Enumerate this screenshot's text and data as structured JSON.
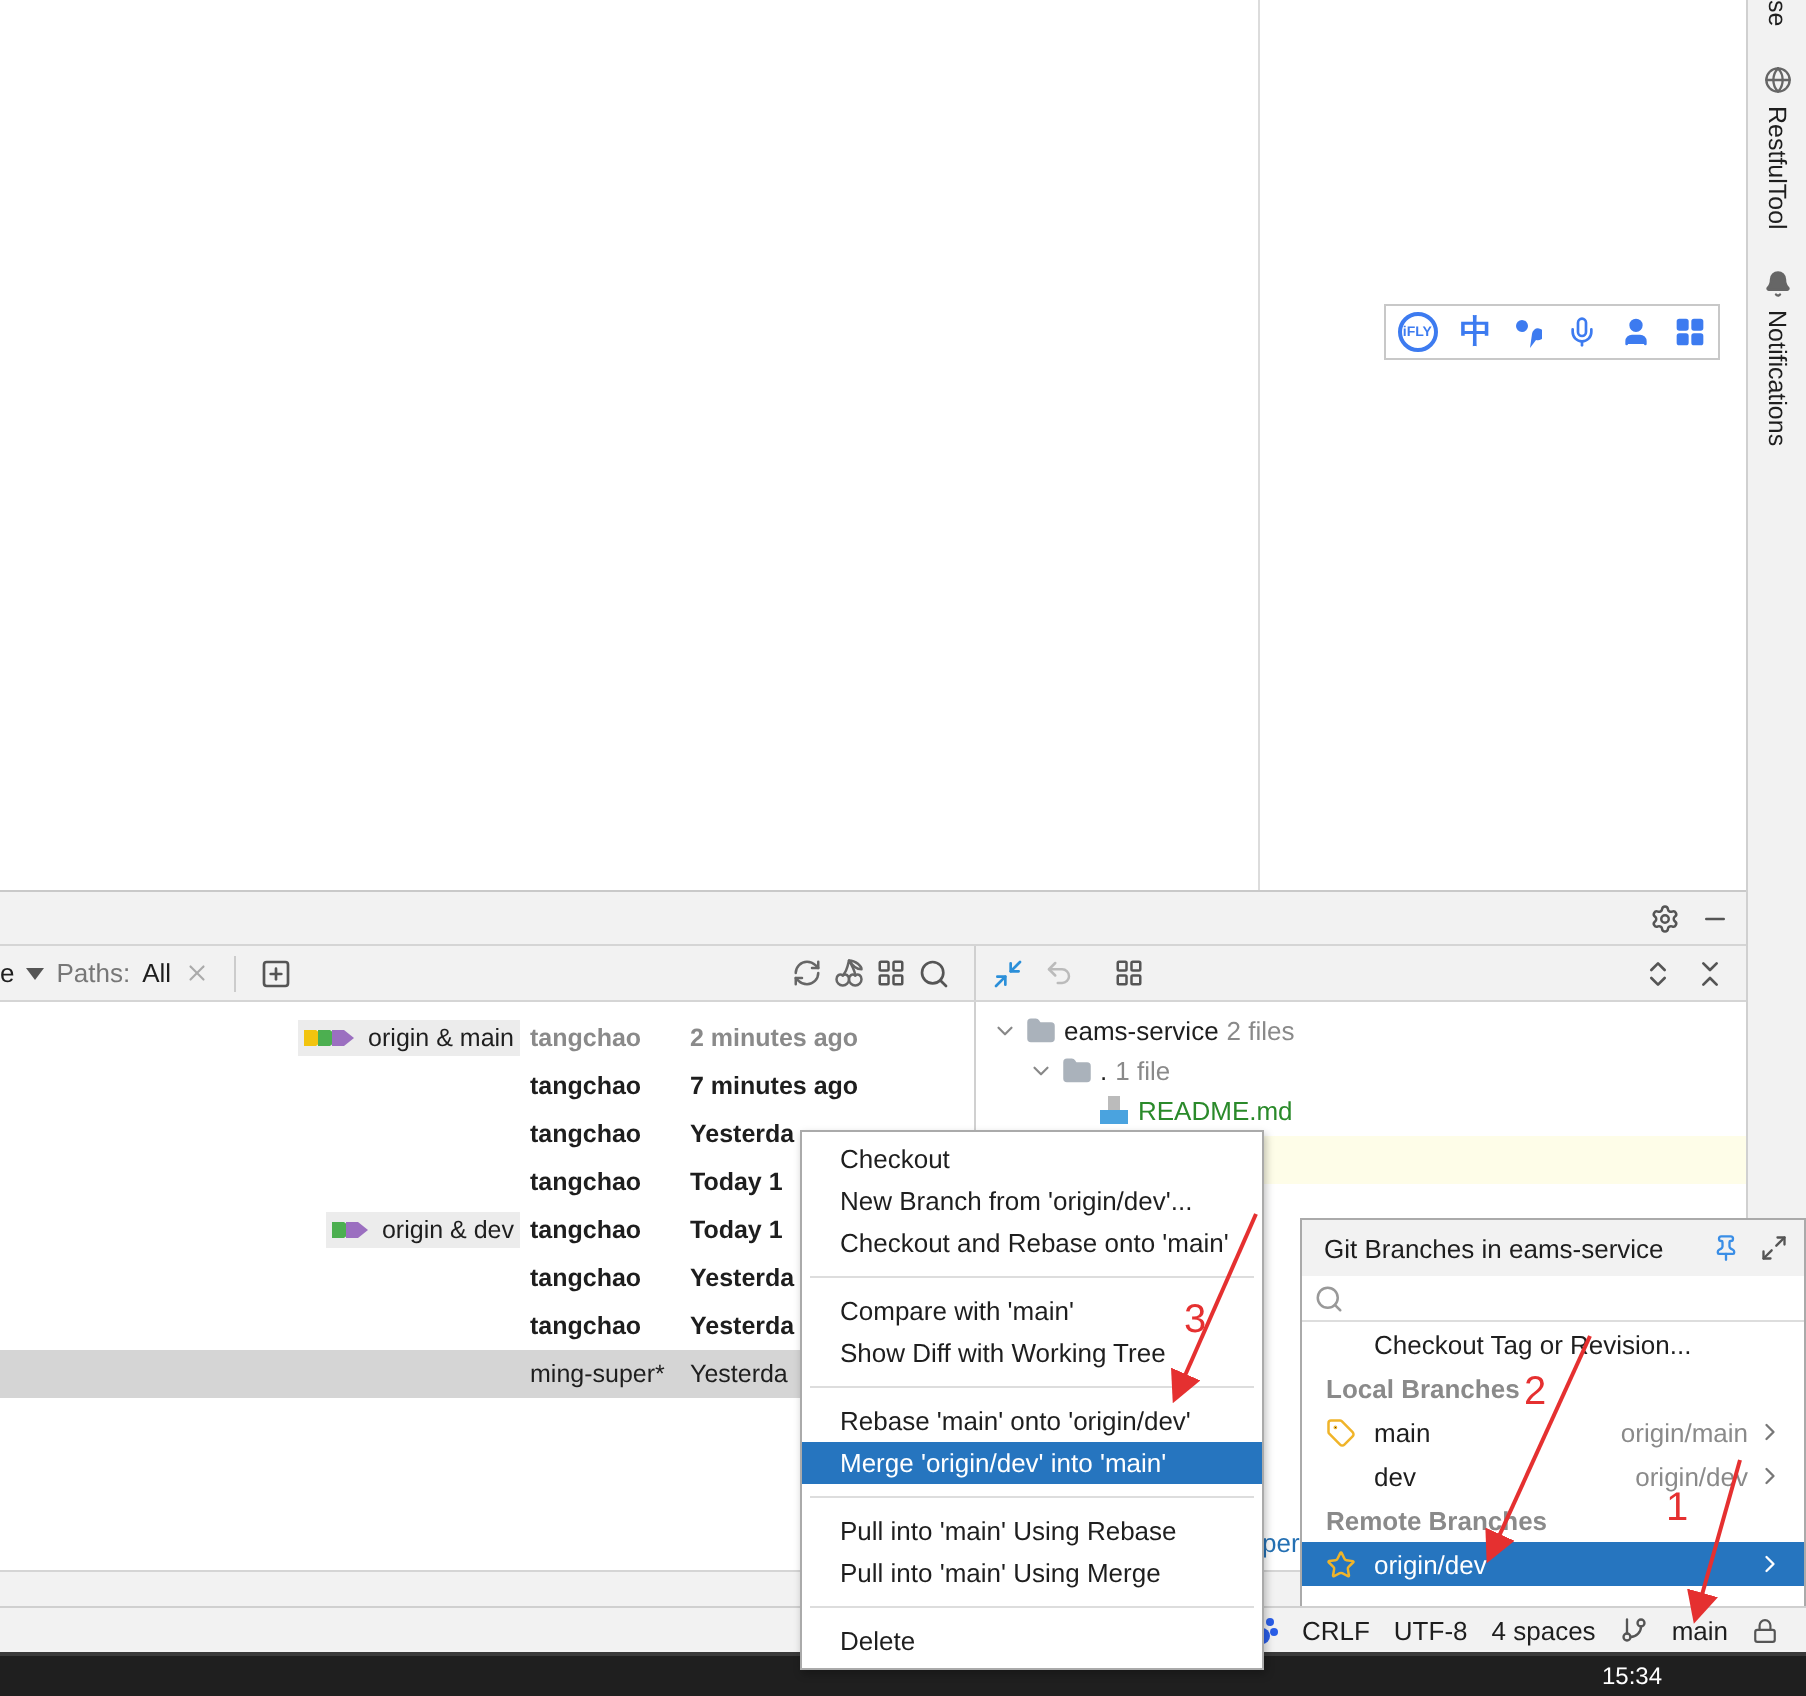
{
  "tool_strip": [
    "se",
    "RestfulTool",
    "Notifications"
  ],
  "ifly_toolbar": {
    "logo": "iFLY",
    "language": "中"
  },
  "log_toolbar": {
    "filter_cut": "e",
    "paths_label": "Paths:",
    "paths_value": "All"
  },
  "log_rows": [
    {
      "refs": "origin & main",
      "tags": [
        {
          "color": "#f2c40f"
        },
        {
          "color": "#4caf50"
        },
        {
          "color": "#9b6fc0"
        }
      ],
      "author": "tangchao",
      "date": "2 minutes ago",
      "bold": true,
      "dimmed": true,
      "selected": false
    },
    {
      "author": "tangchao",
      "date": "7 minutes ago",
      "bold": true,
      "dimmed": false,
      "selected": false
    },
    {
      "author": "tangchao",
      "date": "Yesterda",
      "bold": true,
      "dimmed": false,
      "selected": false
    },
    {
      "author": "tangchao",
      "date": "Today 1",
      "bold": true,
      "dimmed": false,
      "selected": false
    },
    {
      "refs": "origin & dev",
      "tags": [
        {
          "color": "#4caf50"
        },
        {
          "color": "#9b6fc0"
        }
      ],
      "author": "tangchao",
      "date": "Today 1",
      "bold": true,
      "dimmed": false,
      "selected": false
    },
    {
      "author": "tangchao",
      "date": "Yesterda",
      "bold": true,
      "dimmed": false,
      "selected": false
    },
    {
      "author": "tangchao",
      "date": "Yesterda",
      "bold": true,
      "dimmed": false,
      "selected": false
    },
    {
      "author": "ming-super*",
      "date": "Yesterda",
      "bold": false,
      "dimmed": false,
      "selected": true
    }
  ],
  "changes_tree": [
    {
      "name": "eams-service",
      "count": "2 files",
      "expanded": true,
      "children": [
        {
          "name": ".",
          "count": "1 file",
          "expanded": true,
          "children": [
            {
              "name": "README.md"
            }
          ]
        }
      ]
    }
  ],
  "changes_link_fragment": "per",
  "context_menu": [
    [
      {
        "label": "Checkout",
        "selected": false
      },
      {
        "label": "New Branch from 'origin/dev'...",
        "selected": false
      },
      {
        "label": "Checkout and Rebase onto 'main'",
        "selected": false
      }
    ],
    [
      {
        "label": "Compare with 'main'",
        "selected": false
      },
      {
        "label": "Show Diff with Working Tree",
        "selected": false
      }
    ],
    [
      {
        "label": "Rebase 'main' onto 'origin/dev'",
        "selected": false
      },
      {
        "label": "Merge 'origin/dev' into 'main'",
        "selected": true
      }
    ],
    [
      {
        "label": "Pull into 'main' Using Rebase",
        "selected": false
      },
      {
        "label": "Pull into 'main' Using Merge",
        "selected": false
      }
    ],
    [
      {
        "label": "Delete",
        "selected": false
      }
    ]
  ],
  "branches_popup": {
    "title": "Git Branches in eams-service",
    "items": [
      {
        "kind": "action",
        "label": "Checkout Tag or Revision..."
      },
      {
        "kind": "header",
        "label": "Local Branches"
      },
      {
        "kind": "branch",
        "label": "main",
        "tracking": "origin/main",
        "current": true,
        "favorite": false,
        "selected": false
      },
      {
        "kind": "branch",
        "label": "dev",
        "tracking": "origin/dev",
        "current": false,
        "favorite": false,
        "selected": false
      },
      {
        "kind": "header",
        "label": "Remote Branches"
      },
      {
        "kind": "branch",
        "label": "origin/dev",
        "current": false,
        "favorite": true,
        "selected": true
      }
    ]
  },
  "status_bar": {
    "line_ending": "CRLF",
    "encoding": "UTF-8",
    "indent": "4 spaces",
    "branch": "main"
  },
  "taskbar": {
    "clock": "15:34"
  },
  "annotations": [
    {
      "label": "1"
    },
    {
      "label": "2"
    },
    {
      "label": "3"
    }
  ]
}
